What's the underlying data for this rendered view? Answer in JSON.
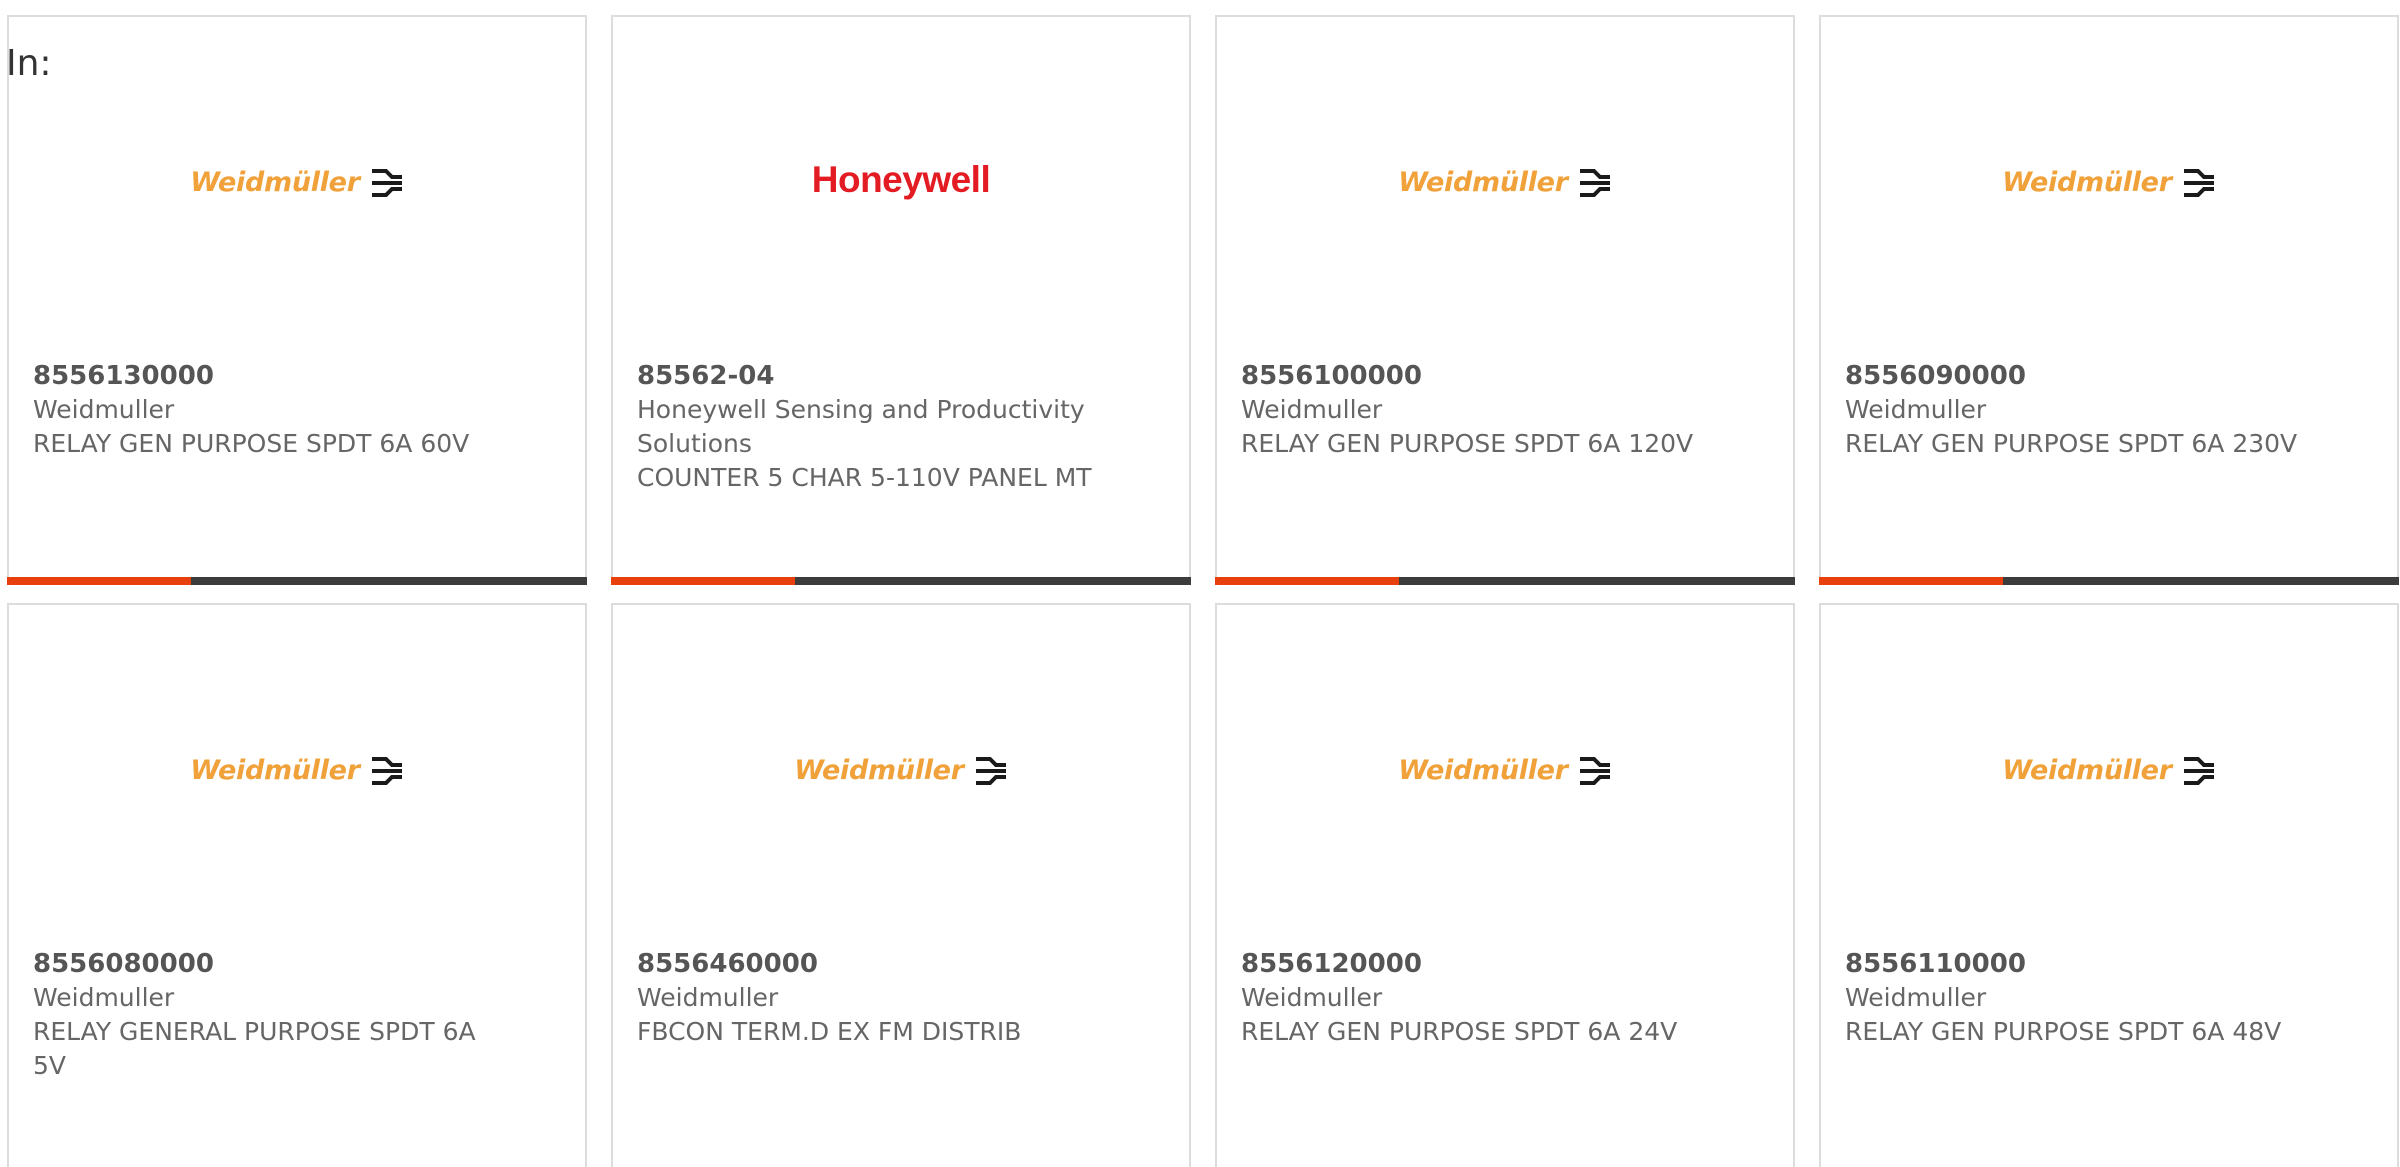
{
  "filter": {
    "label": "In:"
  },
  "brand_colors": {
    "weidmuller": "#f0a13a",
    "honeywell": "#e31b23",
    "accent_bar": "#e8400c",
    "bar": "#3c3c3c"
  },
  "products": [
    {
      "part_number": "8556130000",
      "manufacturer": "Weidmuller",
      "description": "RELAY GEN PURPOSE SPDT 6A 60V",
      "logo": "Weidmüller",
      "logo_icon": "weidmuller-logo-icon"
    },
    {
      "part_number": "85562-04",
      "manufacturer": "Honeywell Sensing and Productivity Solutions",
      "description": "COUNTER 5 CHAR 5-110V PANEL MT",
      "logo": "Honeywell",
      "logo_icon": "honeywell-logo-icon"
    },
    {
      "part_number": "8556100000",
      "manufacturer": "Weidmuller",
      "description": "RELAY GEN PURPOSE SPDT 6A 120V",
      "logo": "Weidmüller",
      "logo_icon": "weidmuller-logo-icon"
    },
    {
      "part_number": "8556090000",
      "manufacturer": "Weidmuller",
      "description": "RELAY GEN PURPOSE SPDT 6A 230V",
      "logo": "Weidmüller",
      "logo_icon": "weidmuller-logo-icon"
    },
    {
      "part_number": "8556080000",
      "manufacturer": "Weidmuller",
      "description": "RELAY GENERAL PURPOSE SPDT 6A 5V",
      "logo": "Weidmüller",
      "logo_icon": "weidmuller-logo-icon"
    },
    {
      "part_number": "8556460000",
      "manufacturer": "Weidmuller",
      "description": "FBCON TERM.D EX FM DISTRIB",
      "logo": "Weidmüller",
      "logo_icon": "weidmuller-logo-icon"
    },
    {
      "part_number": "8556120000",
      "manufacturer": "Weidmuller",
      "description": "RELAY GEN PURPOSE SPDT 6A 24V",
      "logo": "Weidmüller",
      "logo_icon": "weidmuller-logo-icon"
    },
    {
      "part_number": "8556110000",
      "manufacturer": "Weidmuller",
      "description": "RELAY GEN PURPOSE SPDT 6A 48V",
      "logo": "Weidmüller",
      "logo_icon": "weidmuller-logo-icon"
    }
  ]
}
